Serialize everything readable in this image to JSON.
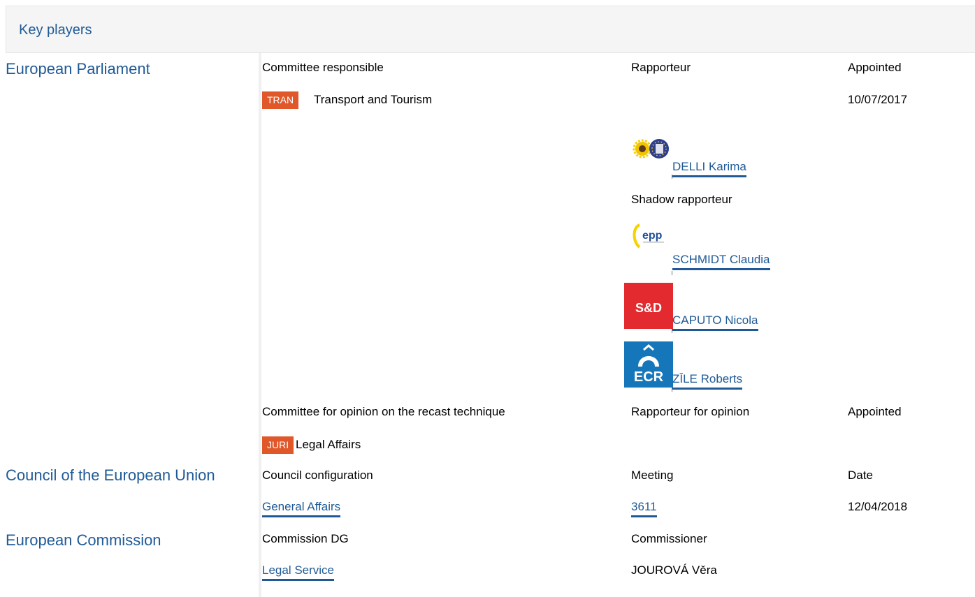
{
  "header": {
    "title": "Key players"
  },
  "ep": {
    "title": "European Parliament",
    "committee_label": "Committee responsible",
    "rapporteur_label": "Rapporteur",
    "appointed_label": "Appointed",
    "committee_code": "TRAN",
    "committee_name": "Transport and Tourism",
    "appointed_date": "10/07/2017",
    "rapporteur": {
      "name": "DELLI Karima",
      "group_icon": "greens-efa-logo"
    },
    "shadow_label": "Shadow rapporteur",
    "shadows": [
      {
        "name": "SCHMIDT Claudia",
        "group_icon": "epp-logo"
      },
      {
        "name": "CAPUTO Nicola",
        "group_icon": "sd-logo",
        "logo_text": "S&D"
      },
      {
        "name": "ZĪLE Roberts",
        "group_icon": "ecr-logo",
        "logo_text": "ECR"
      }
    ],
    "opinion_label": "Committee for opinion on the recast technique",
    "opinion_rapporteur_label": "Rapporteur for opinion",
    "opinion_appointed_label": "Appointed",
    "opinion_code": "JURI",
    "opinion_name": "Legal Affairs",
    "epp_logo_text": "epp"
  },
  "council": {
    "title": "Council of the European Union",
    "config_label": "Council configuration",
    "meeting_label": "Meeting",
    "date_label": "Date",
    "config_value": "General Affairs",
    "meeting_value": "3611",
    "date_value": "12/04/2018"
  },
  "commission": {
    "title": "European Commission",
    "dg_label": "Commission DG",
    "commissioner_label": "Commissioner",
    "dg_value": "Legal Service",
    "commissioner_value": "JOUROVÁ Věra"
  },
  "colors": {
    "accent": "#1f5a96",
    "badge": "#e0572a",
    "sd_red": "#e32a2e",
    "ecr_blue": "#1577ba"
  }
}
